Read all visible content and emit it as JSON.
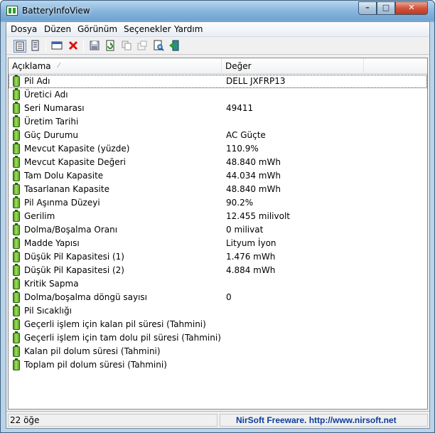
{
  "window": {
    "title": "BatteryInfoView"
  },
  "menu": [
    "Dosya",
    "Düzen",
    "Görünüm",
    "Seçenekler",
    "Yardım"
  ],
  "toolbar": {
    "icons": [
      "html-report-icon",
      "properties-icon",
      "window-icon",
      "delete-icon",
      "save-icon",
      "refresh-icon",
      "copy-icon",
      "options-icon",
      "find-icon",
      "exit-icon"
    ]
  },
  "columns": [
    "Açıklama",
    "Değer"
  ],
  "rows": [
    {
      "name": "Pil Adı",
      "value": "DELL JXFRP13"
    },
    {
      "name": "Üretici Adı",
      "value": ""
    },
    {
      "name": "Seri Numarası",
      "value": "49411"
    },
    {
      "name": "Üretim Tarihi",
      "value": ""
    },
    {
      "name": "Güç Durumu",
      "value": "AC Güçte"
    },
    {
      "name": "Mevcut Kapasite (yüzde)",
      "value": "110.9%"
    },
    {
      "name": "Mevcut Kapasite Değeri",
      "value": "48.840 mWh"
    },
    {
      "name": "Tam Dolu Kapasite",
      "value": "44.034 mWh"
    },
    {
      "name": "Tasarlanan Kapasite",
      "value": "48.840 mWh"
    },
    {
      "name": "Pil Aşınma Düzeyi",
      "value": "90.2%"
    },
    {
      "name": "Gerilim",
      "value": "12.455 milivolt"
    },
    {
      "name": "Dolma/Boşalma Oranı",
      "value": "0 milivat"
    },
    {
      "name": "Madde Yapısı",
      "value": "Lityum İyon"
    },
    {
      "name": "Düşük Pil Kapasitesi (1)",
      "value": "1.476 mWh"
    },
    {
      "name": "Düşük Pil Kapasitesi (2)",
      "value": "4.884 mWh"
    },
    {
      "name": "Kritik Sapma",
      "value": ""
    },
    {
      "name": "Dolma/boşalma döngü sayısı",
      "value": "0"
    },
    {
      "name": "Pil Sıcaklığı",
      "value": ""
    },
    {
      "name": "Geçerli işlem için kalan pil süresi (Tahmini)",
      "value": ""
    },
    {
      "name": "Geçerli işlem için tam dolu pil süresi (Tahmini)",
      "value": ""
    },
    {
      "name": "Kalan pil dolum süresi (Tahmini)",
      "value": ""
    },
    {
      "name": "Toplam pil dolum süresi (Tahmini)",
      "value": ""
    }
  ],
  "status": {
    "count": "22 öğe",
    "credit": "NirSoft Freeware.  http://www.nirsoft.net"
  },
  "colors": {
    "link": "#0b3c9c",
    "battery": "#5ea42a"
  }
}
